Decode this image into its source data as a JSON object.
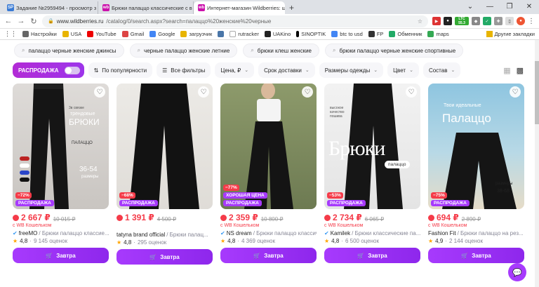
{
  "browser": {
    "tabs": [
      {
        "label": "Задание №2959494 - просмотр з",
        "favicon": "SP",
        "color": "#3a7bd5"
      },
      {
        "label": "Брюки палаццо классические с в",
        "favicon": "wb",
        "color": "#cb11ab"
      },
      {
        "label": "Интернет-магазин Wildberries: ш",
        "favicon": "wb",
        "color": "#cb11ab"
      }
    ],
    "new_tab": "+",
    "url_host": "www.wildberries.ru",
    "url_path": "/catalog/0/search.aspx?search=палаццо%20женские%20черные",
    "bookmarks": [
      "Настройки",
      "USA",
      "YouTube",
      "Gmail",
      "Google",
      "загрузчик",
      "rutracker",
      "UAKino",
      "SINOPTIK",
      "btc to usd",
      "FP",
      "Обменник",
      "maps"
    ],
    "bookmarks_other": "Другие закладки",
    "ext_ltc": "LTC",
    "ext_ltc_val": "55.3"
  },
  "suggestions": [
    "палаццо черные женские джинсы",
    "черные палаццо женские летние",
    "брюки клеш женские",
    "брюки палаццо черные женские спортивные"
  ],
  "filters": {
    "sale_label": "РАСПРОДАЖА",
    "sort": "По популярности",
    "all_filters": "Все фильтры",
    "price": "Цена, ₽",
    "delivery": "Срок доставки",
    "size": "Размеры одежды",
    "color": "Цвет",
    "composition": "Состав"
  },
  "products": [
    {
      "price": "2 667 ₽",
      "old_price": "10 015 ₽",
      "wallet": "с WB Кошельком",
      "brand": "freeMO",
      "name": "/ Брюки палаццо классие...",
      "verified": true,
      "rating": "4,8",
      "reviews": "9 145 оценок",
      "discount": "−72%",
      "badge": "РАСПРОДАЖА",
      "cart": "Завтра",
      "overlay": [
        "3в связке",
        "трендовые",
        "БРЮКИ",
        "ПАЛАЦЦО",
        "36-54",
        "размеры"
      ]
    },
    {
      "price": "1 391 ₽",
      "old_price": "4 500 ₽",
      "wallet": "",
      "brand": "tatyna brand official",
      "name": "/ Брюки палац...",
      "verified": false,
      "rating": "4,8",
      "reviews": "295 оценок",
      "discount": "−68%",
      "badge": "РАСПРОДАЖА",
      "cart": "Завтра",
      "overlay": []
    },
    {
      "price": "2 359 ₽",
      "old_price": "10 800 ₽",
      "wallet": "с WB Кошельком",
      "brand": "NS dream",
      "name": "/ Брюки палаццо классиче...",
      "verified": true,
      "rating": "4,8",
      "reviews": "4 369 оценок",
      "discount": "−77%",
      "badge": "РАСПРОДАЖА",
      "good_price": "ХОРОШАЯ ЦЕНА",
      "cart": "Завтра",
      "overlay": []
    },
    {
      "price": "2 734 ₽",
      "old_price": "6 065 ₽",
      "wallet": "с WB Кошельком",
      "brand": "Kamilek",
      "name": "/ Брюки классические па...",
      "verified": true,
      "rating": "4,8",
      "reviews": "6 500 оценок",
      "discount": "−53%",
      "badge": "РАСПРОДАЖА",
      "cart": "Завтра",
      "overlay": [
        "Брюки",
        "палаццо",
        "высокое",
        "качество",
        "пошива"
      ]
    },
    {
      "price": "694 ₽",
      "old_price": "2 890 ₽",
      "wallet": "с WB Кошельком",
      "brand": "Fashion Fit",
      "name": "/ Брюки палаццо на рез...",
      "verified": false,
      "rating": "4,9",
      "reviews": "2 144 оценок",
      "discount": "−75%",
      "badge": "РАСПРОДАЖА",
      "cart": "Завтра",
      "overlay": [
        "Твои идеальные",
        "Палаццо",
        "размеры",
        "38-68"
      ]
    }
  ],
  "colors": {
    "accent": "#a73afd",
    "price": "#f53b49",
    "brand_tab": "#cb11ab"
  }
}
